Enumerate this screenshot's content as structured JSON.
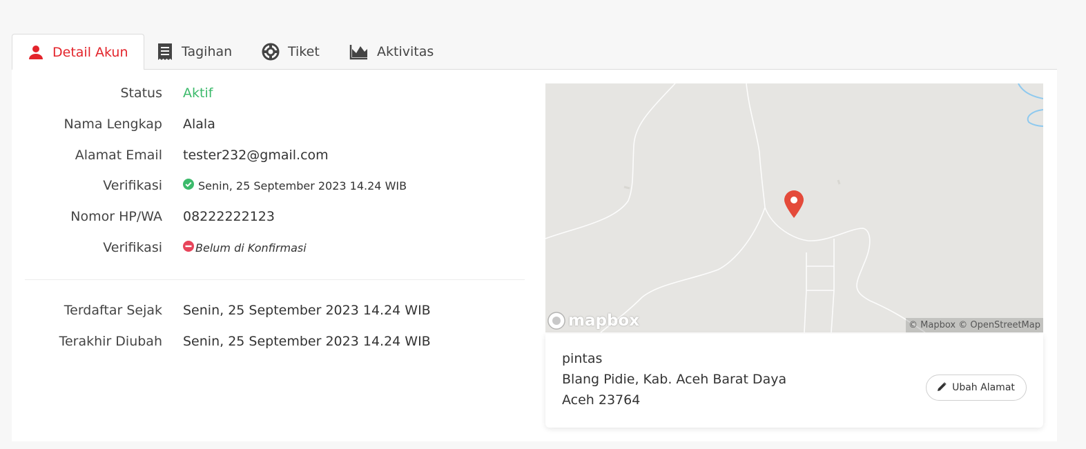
{
  "tabs": [
    {
      "label": "Detail Akun",
      "icon": "user-icon",
      "active": true
    },
    {
      "label": "Tagihan",
      "icon": "receipt-icon",
      "active": false
    },
    {
      "label": "Tiket",
      "icon": "lifebuoy-icon",
      "active": false
    },
    {
      "label": "Aktivitas",
      "icon": "area-chart-icon",
      "active": false
    }
  ],
  "account": {
    "status_label": "Status",
    "status_value": "Aktif",
    "name_label": "Nama Lengkap",
    "name_value": "Alala",
    "email_label": "Alamat Email",
    "email_value": "tester232@gmail.com",
    "email_verif_label": "Verifikasi",
    "email_verif_value": "Senin, 25 September 2023 14.24 WIB",
    "phone_label": "Nomor HP/WA",
    "phone_value": "08222222123",
    "phone_verif_label": "Verifikasi",
    "phone_verif_value": "Belum di Konfirmasi",
    "registered_label": "Terdaftar Sejak",
    "registered_value": "Senin, 25 September 2023 14.24 WIB",
    "updated_label": "Terakhir Diubah",
    "updated_value": "Senin, 25 September 2023 14.24 WIB"
  },
  "map": {
    "logo": "mapbox",
    "attribution": "© Mapbox © OpenStreetMap"
  },
  "address": {
    "line1": "pintas",
    "line2": "Blang Pidie, Kab. Aceh Barat Daya",
    "line3": "Aceh 23764",
    "edit_button": "Ubah Alamat"
  },
  "colors": {
    "accent": "#e3242b",
    "success": "#3cba6b",
    "danger": "#e8445a"
  }
}
